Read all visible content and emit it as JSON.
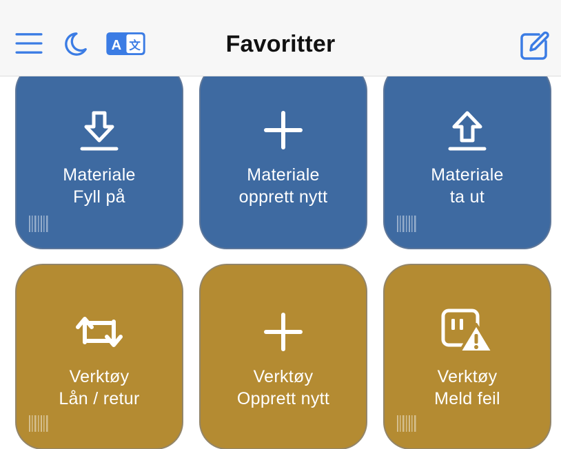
{
  "theme": {
    "accent": "#3b7ce4",
    "tile_blue": "#3e6aa1",
    "tile_gold": "#b48b32",
    "header_bg": "#f7f7f7"
  },
  "header": {
    "title": "Favoritter",
    "menu_icon": "hamburger-menu-icon",
    "theme_icon": "moon-icon",
    "language_icon": "translate-icon",
    "language_icon_text": "A文",
    "edit_icon": "edit-square-pencil-icon"
  },
  "tiles": [
    {
      "line1": "Materiale",
      "line2": "Fyll på",
      "icon": "download-tray-icon",
      "color": "blue",
      "barcode": true
    },
    {
      "line1": "Materiale",
      "line2": "opprett nytt",
      "icon": "plus-icon",
      "color": "blue",
      "barcode": false
    },
    {
      "line1": "Materiale",
      "line2": "ta ut",
      "icon": "upload-tray-icon",
      "color": "blue",
      "barcode": true
    },
    {
      "line1": "Verktøy",
      "line2": "Lån / retur",
      "icon": "repeat-arrows-icon",
      "color": "gold",
      "barcode": true
    },
    {
      "line1": "Verktøy",
      "line2": "Opprett nytt",
      "icon": "plus-icon",
      "color": "gold",
      "barcode": false
    },
    {
      "line1": "Verktøy",
      "line2": "Meld feil",
      "icon": "warning-board-icon",
      "color": "gold",
      "barcode": true
    }
  ]
}
